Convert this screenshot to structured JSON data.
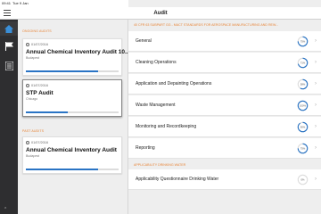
{
  "status_bar": {
    "time": "09:41",
    "date": "Tue 9 Jan"
  },
  "nav": {
    "title": "Audit"
  },
  "left": {
    "ongoing_title": "ONGOING AUDITS",
    "past_title": "PAST AUDITS",
    "ongoing": [
      {
        "date": "01/07/2016",
        "name": "Annual Chemical Inventory Audit 10...",
        "location": "Budapest",
        "progress": 0.78,
        "selected": false
      },
      {
        "date": "01/07/2016",
        "name": "STP Audit",
        "location": "Chicago",
        "progress": 0.45,
        "selected": true
      }
    ],
    "past": [
      {
        "date": "01/07/2016",
        "name": "Annual Chemical Inventory Audit",
        "location": "Budapest",
        "progress": 0.78
      }
    ]
  },
  "right": {
    "sections": [
      {
        "title": "40 CFR 63 SUBPART GG - MACT STANDARDS FOR AEROSPACE MANUFACTURING AND REW...",
        "rows": [
          {
            "label": "General",
            "percent": 75,
            "percent_text": "75%"
          },
          {
            "label": "Cleaning Operations",
            "percent": 71,
            "percent_text": "71%"
          },
          {
            "label": "Application and Depainting Operations",
            "percent": 58,
            "percent_text": "58%"
          },
          {
            "label": "Waste Management",
            "percent": 100,
            "percent_text": "100%"
          },
          {
            "label": "Monitoring and Recordkeeping",
            "percent": 90,
            "percent_text": "90%"
          },
          {
            "label": "Reporting",
            "percent": 75,
            "percent_text": "75%"
          }
        ]
      },
      {
        "title": "APPLICABILITY DRINKING WATER",
        "rows": [
          {
            "label": "Applicability Questionnaire Drinking Water",
            "percent": 0,
            "percent_text": "0%"
          }
        ]
      }
    ]
  },
  "colors": {
    "accent_orange": "#e8863a",
    "progress_blue": "#2a74c4",
    "rail_dark": "#2e2e30"
  },
  "icons": {
    "menu": "hamburger-icon",
    "rail": [
      "home-icon",
      "flag-icon",
      "list-icon"
    ],
    "row_chevron": "chevron-right-icon",
    "card_date": "clock-icon"
  }
}
